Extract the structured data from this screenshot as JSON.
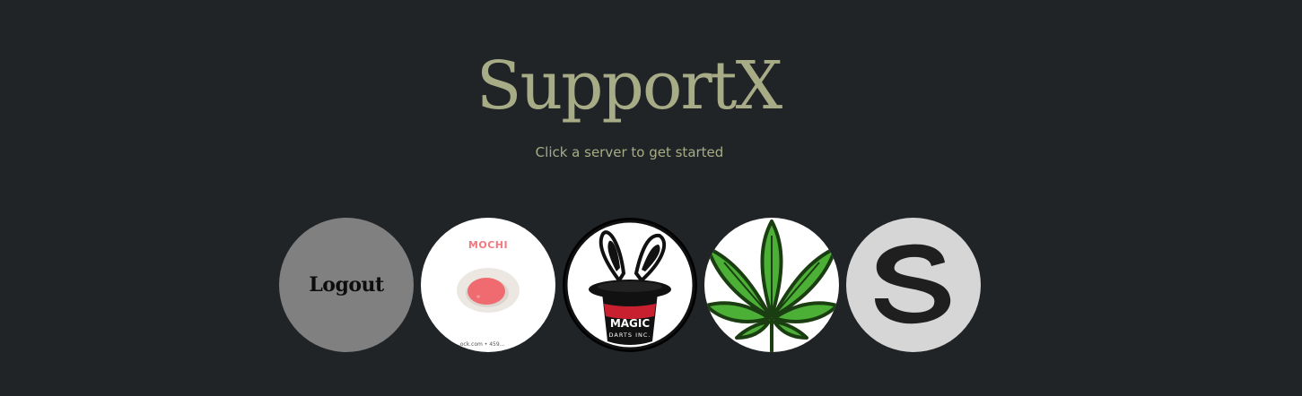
{
  "header": {
    "title": "SupportX",
    "subtitle": "Click a server to get started"
  },
  "servers": [
    {
      "label": "Logout",
      "kind": "logout",
      "background": "#808080"
    },
    {
      "label": "MOCHI",
      "footer": "...ock.com • 459...",
      "kind": "server",
      "icon": "mochi-logo",
      "background": "#ffffff",
      "accent": "#f07a80"
    },
    {
      "label": "MAGIC",
      "sublabel": "DARTS INC.",
      "kind": "server",
      "icon": "magic-hat-rabbit-logo",
      "background": "#ffffff",
      "accent": "#c8202f"
    },
    {
      "kind": "server",
      "icon": "cannabis-leaf-logo",
      "background": "#ffffff",
      "accent": "#4caf36"
    },
    {
      "kind": "server",
      "icon": "letter-s-logo",
      "background": "#d6d6d6"
    }
  ],
  "theme": {
    "background": "#212427",
    "accent": "#a7ac86"
  }
}
